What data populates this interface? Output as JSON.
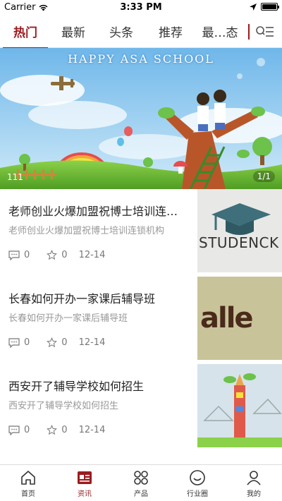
{
  "status": {
    "carrier": "Carrier",
    "time": "3:33 PM"
  },
  "tabs": [
    {
      "label": "热门",
      "active": true
    },
    {
      "label": "最新",
      "active": false
    },
    {
      "label": "头条",
      "active": false
    },
    {
      "label": "推荐",
      "active": false
    },
    {
      "label": "最…态",
      "active": false
    }
  ],
  "banner": {
    "title": "HAPPY ASA SCHOOL",
    "left_text": "111",
    "counter": "1/1"
  },
  "articles": [
    {
      "title": "老师创业火爆加盟祝博士培训连…",
      "subtitle": "老师创业火爆加盟祝博士培训连锁机构",
      "comments": "0",
      "stars": "0",
      "date": "12-14",
      "thumb_text": "STUDENCK"
    },
    {
      "title": "长春如何开办一家课后辅导班",
      "subtitle": "长春如何开办一家课后辅导班",
      "comments": "0",
      "stars": "0",
      "date": "12-14",
      "thumb_text": "alle"
    },
    {
      "title": "西安开了辅导学校如何招生",
      "subtitle": "西安开了辅导学校如何招生",
      "comments": "0",
      "stars": "0",
      "date": "12-14",
      "thumb_text": ""
    }
  ],
  "bottom_nav": [
    {
      "label": "首页",
      "icon": "home-icon",
      "active": false
    },
    {
      "label": "资讯",
      "icon": "news-icon",
      "active": true
    },
    {
      "label": "产品",
      "icon": "grid-icon",
      "active": false
    },
    {
      "label": "行业圈",
      "icon": "circle-face-icon",
      "active": false
    },
    {
      "label": "我的",
      "icon": "user-icon",
      "active": false
    }
  ],
  "colors": {
    "accent": "#9c1b1f"
  }
}
